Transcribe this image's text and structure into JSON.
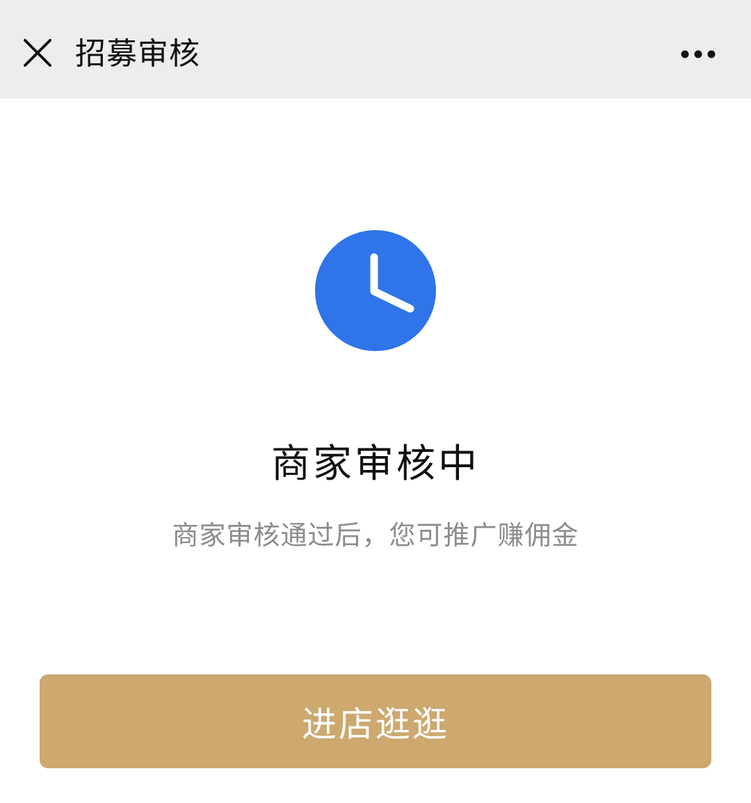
{
  "header": {
    "title": "招募审核",
    "close_icon": "close-icon",
    "more_icon": "more-horizontal-icon"
  },
  "status": {
    "icon": "clock-icon",
    "icon_color": "#2f74e8",
    "title": "商家审核中",
    "description": "商家审核通过后，您可推广赚佣金"
  },
  "action": {
    "button_label": "进店逛逛",
    "button_color": "#cda86f"
  },
  "colors": {
    "header_bg": "#ededed",
    "page_bg": "#ffffff"
  }
}
